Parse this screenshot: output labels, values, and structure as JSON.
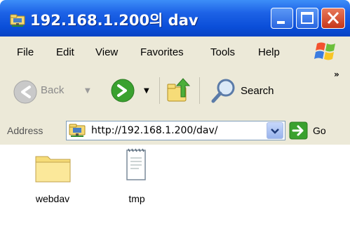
{
  "window": {
    "title": "192.168.1.200의 dav"
  },
  "menu": [
    "File",
    "Edit",
    "View",
    "Favorites",
    "Tools",
    "Help"
  ],
  "toolbar": {
    "back_label": "Back",
    "search_label": "Search",
    "overflow": "»"
  },
  "address": {
    "label": "Address",
    "value": "http://192.168.1.200/dav/",
    "go_label": "Go"
  },
  "files": [
    {
      "name": "webdav",
      "type": "folder-icon"
    },
    {
      "name": "tmp",
      "type": "document-icon"
    }
  ],
  "colors": {
    "titlebar": "#0a4ed8",
    "chrome": "#ece9d8",
    "close": "#c5371b",
    "go_green": "#3aa12f",
    "folder": "#f6dc78"
  }
}
